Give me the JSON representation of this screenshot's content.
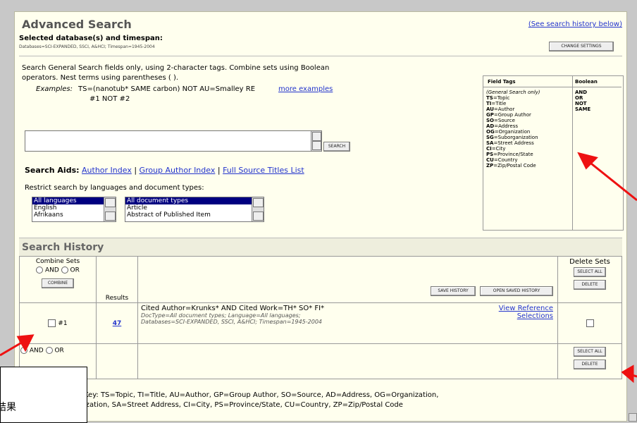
{
  "header": {
    "title": "Advanced Search",
    "history_link": "(See search history below)"
  },
  "db": {
    "label": "Selected database(s) and timespan:",
    "info": "Databases=SCI-EXPANDED, SSCI, A&HCI; Timespan=1945-2004",
    "change_btn": "CHANGE SETTINGS"
  },
  "instructions": {
    "line1": "Search General Search fields only, using 2-character tags. Combine sets using Boolean",
    "line2": "operators. Nest terms using parentheses ( ).",
    "examples_label": "Examples:",
    "example1": "TS=(nanotub* SAME carbon) NOT AU=Smalley RE",
    "more_examples": "more examples",
    "example2": "#1 NOT #2"
  },
  "query": {
    "value": "",
    "search_btn": "SEARCH"
  },
  "aids": {
    "label": "Search Aids:",
    "author_index": "Author Index",
    "sep": "|",
    "group_author_index": "Group Author Index",
    "full_source": "Full Source Titles List"
  },
  "restrict": {
    "label": "Restrict search by languages and document types:",
    "languages": [
      "All languages",
      "English",
      "Afrikaans"
    ],
    "doctypes": [
      "All document types",
      "Article",
      "Abstract of Published Item"
    ]
  },
  "field_tags": {
    "header": "Field Tags",
    "boolean_header": "Boolean",
    "subhead": "(General Search only)",
    "tags": [
      [
        "TS",
        "Topic"
      ],
      [
        "TI",
        "Title"
      ],
      [
        "AU",
        "Author"
      ],
      [
        "GP",
        "Group Author"
      ],
      [
        "SO",
        "Source"
      ],
      [
        "AD",
        "Address"
      ],
      [
        "OG",
        "Organization"
      ],
      [
        "SG",
        "Suborganization"
      ],
      [
        "SA",
        "Street Address"
      ],
      [
        "CI",
        "City"
      ],
      [
        "PS",
        "Province/State"
      ],
      [
        "CU",
        "Country"
      ],
      [
        "ZP",
        "Zip/Postal Code"
      ]
    ],
    "booleans": [
      "AND",
      "OR",
      "NOT",
      "SAME"
    ]
  },
  "history": {
    "title": "Search History",
    "combine_label": "Combine Sets",
    "and_label": "AND",
    "or_label": "OR",
    "combine_btn": "COMBINE",
    "results_label": "Results",
    "save_btn": "SAVE HISTORY",
    "open_btn": "OPEN SAVED HISTORY",
    "delete_label": "Delete Sets",
    "select_all_btn": "SELECT ALL",
    "delete_btn": "DELETE",
    "row": {
      "set": "#1",
      "results": "47",
      "query": "Cited Author=Krunks* AND Cited Work=TH* SO* FI*",
      "details1": "DocType=All document types; Language=All languages;",
      "details2": "Databases=SCI-EXPANDED, SSCI, A&HCI; Timespan=1945-2004",
      "view_ref": "View Reference",
      "selections": "Selections"
    }
  },
  "key": {
    "line1": "Key: TS=Topic, TI=Title, AU=Author, GP=Group Author, SO=Source, AD=Address, OG=Organization,",
    "line2": "ization, SA=Street Address, CI=City, PS=Province/State, CU=Country, ZP=Zip/Postal Code"
  },
  "overlay": {
    "text": "結果"
  },
  "colors": {
    "arrow": "#ee1111",
    "header_bg": "#eeeedd",
    "title_color": "#555555"
  }
}
